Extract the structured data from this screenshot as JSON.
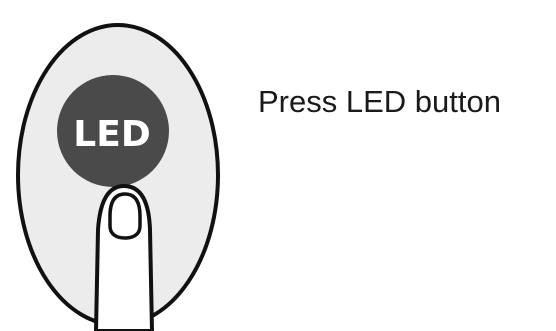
{
  "button": {
    "label": "LED"
  },
  "instruction": {
    "text": "Press LED button"
  },
  "colors": {
    "device_fill": "#ececec",
    "outline": "#111111",
    "button_fill": "#4a4a4a",
    "button_text": "#ffffff",
    "finger_fill": "#ffffff"
  },
  "icons": {
    "device": "oval-remote",
    "pointer": "finger"
  }
}
